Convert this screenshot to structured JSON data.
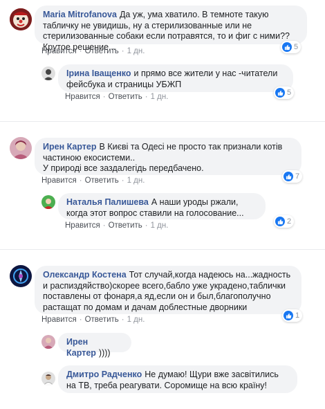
{
  "ui": {
    "like": "Нравится",
    "reply": "Ответить",
    "dot": "·"
  },
  "comments": [
    {
      "author": "Maria Mitrofanova",
      "text": "Да уж, ума хватило. В темноте такую табличку не увидишь, ну а стерилизованные или не стерилизованные собаки если потравятся, то и фиг с ними?? Крутое решение...",
      "time": "1 дн.",
      "reactions": "5",
      "avatar_colors": [
        "#c0392b",
        "#f5e6d3"
      ]
    },
    {
      "author": "Ірина Іващенко",
      "text": "и прямо все жители у нас -читатели фейсбука и страницы УБЖП",
      "time": "1 дн.",
      "reactions": "5",
      "avatar_colors": [
        "#555555",
        "#dddddd"
      ]
    },
    {
      "author": "Ирен Картер",
      "text": "В Києві та Одесі не просто так признали котів частиною екосистеми..\nУ природі все заздалегідь передбачено.",
      "time": "1 дн.",
      "reactions": "7",
      "avatar_colors": [
        "#b85c7a",
        "#e8c9b8"
      ]
    },
    {
      "author": "Наталья Палишева",
      "text": "А наши уроды ржали, когда этот вопрос ставили на голосование...",
      "time": "1 дн.",
      "reactions": "2",
      "avatar_colors": [
        "#2e7d32",
        "#c62828"
      ]
    },
    {
      "author": "Олександр Костена",
      "text": "Тот случай,когда надеюсь на...жадность и распиздяйство)скорее всего,бабло уже украдено,таблички поставлены от фонаря,а яд,если он и был,благополучно растащат по домам и дачам доблестные дворники",
      "time": "1 дн.",
      "reactions": "1",
      "avatar_colors": [
        "#1a237e",
        "#42a5f5"
      ]
    },
    {
      "author": "Ирен Картер",
      "text": "))))",
      "avatar_colors": [
        "#b85c7a",
        "#e8c9b8"
      ]
    },
    {
      "author": "Дмитро Радченко",
      "text": "Не думаю! Щури вже засвітились на ТВ, треба реагувати. Соромище на всю країну!",
      "avatar_colors": [
        "#795548",
        "#e0e0e0"
      ]
    }
  ],
  "colors": {
    "author": "#385898",
    "bubble": "#f2f3f5",
    "like_blue": "#1877f2"
  }
}
